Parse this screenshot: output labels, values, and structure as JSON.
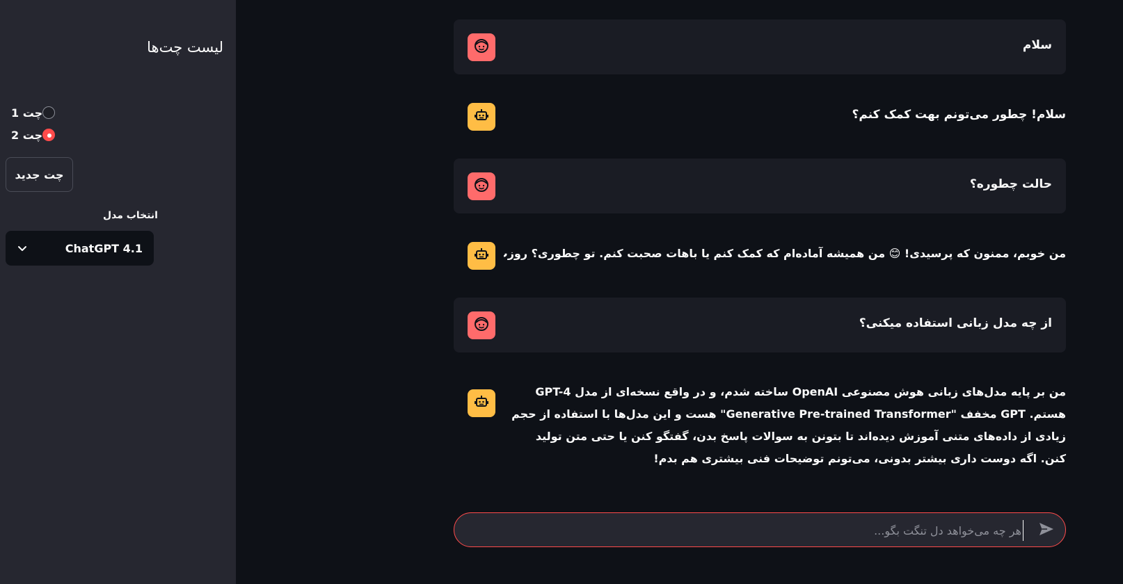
{
  "sidebar": {
    "title": "لیست چت‌ها",
    "chats": [
      {
        "label": "چت 1",
        "selected": false
      },
      {
        "label": "چت 2",
        "selected": true
      }
    ],
    "new_chat_label": "چت جدید",
    "model_label": "انتخاب مدل",
    "model_selected": "ChatGPT 4.1"
  },
  "messages": [
    {
      "role": "user",
      "text": "سلام"
    },
    {
      "role": "assistant",
      "text": "سلام! چطور می‌تونم بهت کمک کنم؟"
    },
    {
      "role": "user",
      "text": "حالت چطوره؟"
    },
    {
      "role": "assistant",
      "text": "من خوبم، ممنون که پرسیدی! 😊 من همیشه آماده‌ام که کمک کنم یا باهات صحبت کنم. تو چطوری؟ روزت چطور گذشته؟"
    },
    {
      "role": "user",
      "text": "از چه مدل زبانی استفاده میکنی؟"
    },
    {
      "role": "assistant",
      "text": "من بر پایه مدل‌های زبانی هوش مصنوعی OpenAI ساخته شدم، و در واقع نسخه‌ای از مدل GPT-4 هستم. GPT مخفف \"Generative Pre-trained Transformer\" هست و این مدل‌ها با استفاده از حجم زیادی از داده‌های متنی آموزش دیده‌اند تا بتونن به سوالات پاسخ بدن، گفتگو کنن یا حتی متن تولید کنن. اگه دوست داری بیشتر بدونی، می‌تونم توضیحات فنی بیشتری هم بدم!"
    }
  ],
  "input": {
    "placeholder": "هر چه می‌خواهد دل تنگت بگو..."
  },
  "colors": {
    "accent": "#ff4b4b",
    "user_avatar": "#ff6b6b",
    "bot_avatar": "#ffbd45",
    "sidebar_bg": "#262730",
    "main_bg": "#0e1117"
  }
}
